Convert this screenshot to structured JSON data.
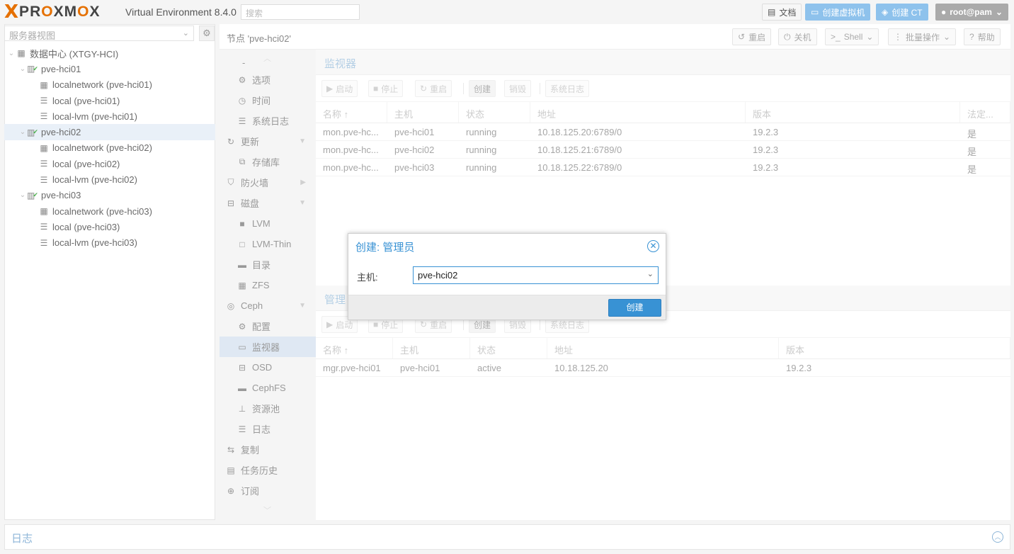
{
  "brand": {
    "name_x": "X",
    "name_rest": "PROXMOX",
    "product": "Virtual Environment 8.4.0"
  },
  "topbar": {
    "search_placeholder": "搜索",
    "docs": "文档",
    "create_vm": "创建虚拟机",
    "create_ct": "创建 CT",
    "user": "root@pam"
  },
  "sidebar": {
    "view_label": "服务器视图",
    "tree": [
      {
        "label": "数据中心 (XTGY-HCI)",
        "icon": "datacenter-icon",
        "level": 0
      },
      {
        "label": "pve-hci01",
        "icon": "node-icon",
        "level": 1
      },
      {
        "label": "localnetwork (pve-hci01)",
        "icon": "network-icon",
        "level": 2
      },
      {
        "label": "local (pve-hci01)",
        "icon": "storage-icon",
        "level": 2
      },
      {
        "label": "local-lvm (pve-hci01)",
        "icon": "storage-icon",
        "level": 2
      },
      {
        "label": "pve-hci02",
        "icon": "node-icon",
        "level": 1
      },
      {
        "label": "localnetwork (pve-hci02)",
        "icon": "network-icon",
        "level": 2
      },
      {
        "label": "local (pve-hci02)",
        "icon": "storage-icon",
        "level": 2
      },
      {
        "label": "local-lvm (pve-hci02)",
        "icon": "storage-icon",
        "level": 2
      },
      {
        "label": "pve-hci03",
        "icon": "node-icon",
        "level": 1
      },
      {
        "label": "localnetwork (pve-hci03)",
        "icon": "network-icon",
        "level": 2
      },
      {
        "label": "local (pve-hci03)",
        "icon": "storage-icon",
        "level": 2
      },
      {
        "label": "local-lvm (pve-hci03)",
        "icon": "storage-icon",
        "level": 2
      }
    ]
  },
  "node": {
    "title": "节点 'pve-hci02'",
    "reboot": "重启",
    "shutdown": "关机",
    "shell": "Shell",
    "bulk": "批量操作",
    "help": "帮助"
  },
  "nav": {
    "items": [
      {
        "label": "-",
        "icon": "",
        "level": 1
      },
      {
        "label": "选项",
        "icon": "gear-icon",
        "level": 2
      },
      {
        "label": "时间",
        "icon": "clock-icon",
        "level": 2
      },
      {
        "label": "系统日志",
        "icon": "list-icon",
        "level": 2
      },
      {
        "label": "更新",
        "icon": "refresh-icon",
        "level": 1
      },
      {
        "label": "存储库",
        "icon": "copy-icon",
        "level": 2
      },
      {
        "label": "防火墙",
        "icon": "shield-icon",
        "level": 1
      },
      {
        "label": "磁盘",
        "icon": "hdd-icon",
        "level": 1
      },
      {
        "label": "LVM",
        "icon": "square-icon",
        "level": 2
      },
      {
        "label": "LVM-Thin",
        "icon": "square-outline-icon",
        "level": 2
      },
      {
        "label": "目录",
        "icon": "folder-icon",
        "level": 2
      },
      {
        "label": "ZFS",
        "icon": "grid-icon",
        "level": 2
      },
      {
        "label": "Ceph",
        "icon": "ceph-icon",
        "level": 1
      },
      {
        "label": "配置",
        "icon": "gear-icon",
        "level": 2
      },
      {
        "label": "监视器",
        "icon": "monitor-icon",
        "level": 2
      },
      {
        "label": "OSD",
        "icon": "hdd-icon",
        "level": 2
      },
      {
        "label": "CephFS",
        "icon": "folder-icon",
        "level": 2
      },
      {
        "label": "资源池",
        "icon": "sitemap-icon",
        "level": 2
      },
      {
        "label": "日志",
        "icon": "list-icon",
        "level": 2
      },
      {
        "label": "复制",
        "icon": "retweet-icon",
        "level": 1
      },
      {
        "label": "任务历史",
        "icon": "list-alt-icon",
        "level": 1
      },
      {
        "label": "订阅",
        "icon": "support-icon",
        "level": 1
      }
    ]
  },
  "monitor": {
    "title": "监视器",
    "toolbar": {
      "start": "启动",
      "stop": "停止",
      "restart": "重启",
      "create": "创建",
      "destroy": "销毁",
      "syslog": "系统日志"
    },
    "columns": [
      "名称 ↑",
      "主机",
      "状态",
      "地址",
      "版本",
      "法定..."
    ],
    "rows": [
      [
        "mon.pve-hc...",
        "pve-hci01",
        "running",
        "10.18.125.20:6789/0",
        "19.2.3",
        "是"
      ],
      [
        "mon.pve-hc...",
        "pve-hci02",
        "running",
        "10.18.125.21:6789/0",
        "19.2.3",
        "是"
      ],
      [
        "mon.pve-hc...",
        "pve-hci03",
        "running",
        "10.18.125.22:6789/0",
        "19.2.3",
        "是"
      ]
    ]
  },
  "manager": {
    "title": "管理",
    "toolbar": {
      "start": "启动",
      "stop": "停止",
      "restart": "重启",
      "create": "创建",
      "destroy": "销毁",
      "syslog": "系统日志"
    },
    "columns": [
      "名称 ↑",
      "主机",
      "状态",
      "地址",
      "版本"
    ],
    "rows": [
      [
        "mgr.pve-hci01",
        "pve-hci01",
        "active",
        "10.18.125.20",
        "19.2.3"
      ]
    ]
  },
  "dialog": {
    "title": "创建: 管理员",
    "host_label": "主机:",
    "host_value": "pve-hci02",
    "create_button": "创建"
  },
  "log": {
    "title": "日志"
  },
  "colors": {
    "accent": "#3892d4",
    "brand_orange": "#e57000",
    "status_ok": "#4cae4c"
  }
}
